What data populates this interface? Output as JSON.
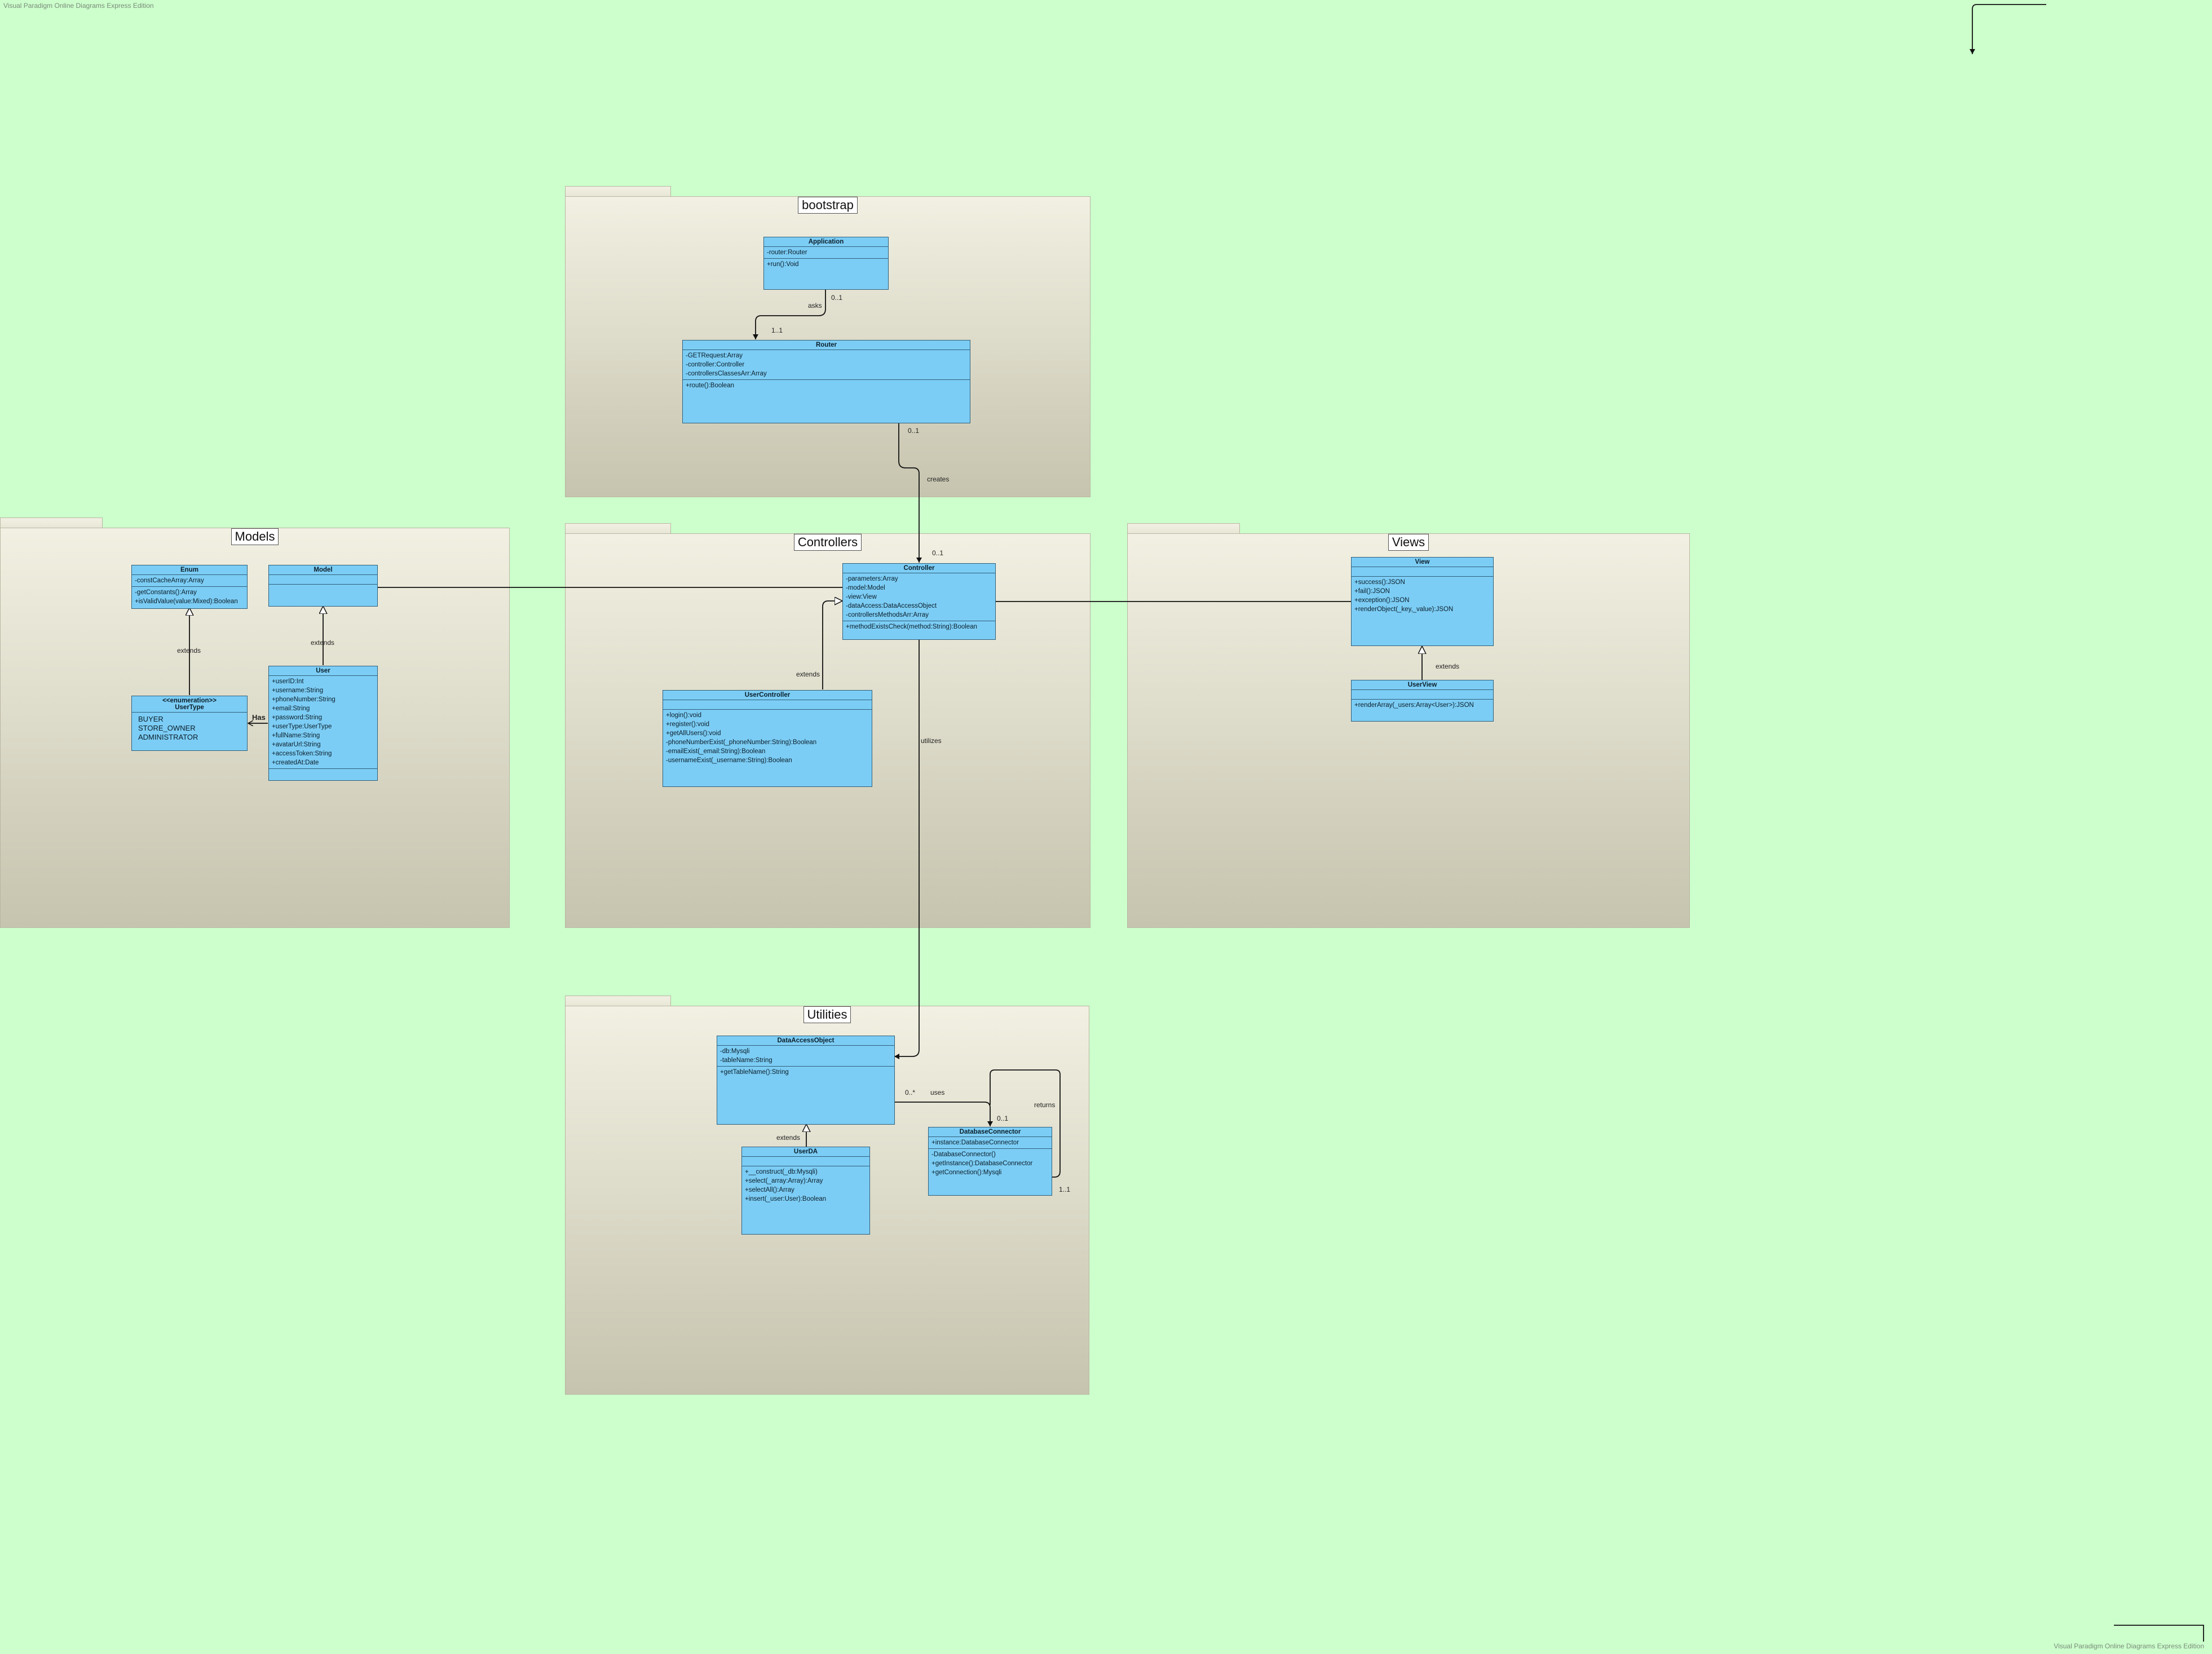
{
  "watermark": "Visual Paradigm Online Diagrams Express Edition",
  "packages": {
    "bootstrap": "bootstrap",
    "models": "Models",
    "controllers": "Controllers",
    "views": "Views",
    "utilities": "Utilities"
  },
  "classes": {
    "application": {
      "name": "Application",
      "attrs": [
        "-router:Router"
      ],
      "ops": [
        "+run():Void"
      ]
    },
    "router": {
      "name": "Router",
      "attrs": [
        "-GETRequest:Array",
        "-controller:Controller",
        "-controllersClassesArr:Array"
      ],
      "ops": [
        "+route():Boolean"
      ]
    },
    "enum": {
      "name": "Enum",
      "attrs": [
        "-constCacheArray:Array"
      ],
      "ops": [
        "-getConstants():Array",
        "+isValidValue(value:Mixed):Boolean"
      ]
    },
    "model": {
      "name": "Model",
      "attrs": [],
      "ops": []
    },
    "usertype": {
      "stereotype": "<<enumeration>>",
      "name": "UserType",
      "literals": [
        "BUYER",
        "STORE_OWNER",
        "ADMINISTRATOR"
      ]
    },
    "user": {
      "name": "User",
      "attrs": [
        "+userID:Int",
        "+username:String",
        "+phoneNumber:String",
        "+email:String",
        "+password:String",
        "+userType:UserType",
        "+fullName:String",
        "+avatarUrl:String",
        "+accessToken:String",
        "+createdAt:Date"
      ],
      "ops": []
    },
    "controller": {
      "name": "Controller",
      "attrs": [
        "-parameters:Array",
        "-model:Model",
        "-view:View",
        "-dataAccess:DataAccessObject",
        "-controllersMethodsArr:Array"
      ],
      "ops": [
        "+methodExistsCheck(method:String):Boolean"
      ]
    },
    "usercontroller": {
      "name": "UserController",
      "attrs": [],
      "ops": [
        "+login():void",
        "+register():void",
        "+getAllUsers():void",
        "-phoneNumberExist(_phoneNumber:String):Boolean",
        "-emailExist(_email:String):Boolean",
        "-usernameExist(_username:String):Boolean"
      ]
    },
    "view": {
      "name": "View",
      "attrs": [],
      "ops": [
        "+success():JSON",
        "+fail():JSON",
        "+exception():JSON",
        "+renderObject(_key,_value):JSON"
      ]
    },
    "userview": {
      "name": "UserView",
      "attrs": [],
      "ops": [
        "+renderArray(_users:Array<User>):JSON"
      ]
    },
    "dao": {
      "name": "DataAccessObject",
      "attrs": [
        "-db:Mysqli",
        "-tableName:String"
      ],
      "ops": [
        "+getTableName():String"
      ]
    },
    "userda": {
      "name": "UserDA",
      "attrs": [],
      "ops": [
        "+__construct(_db:Mysqli)",
        "+select(_array:Array):Array",
        "+selectAll():Array",
        "+insert(_user:User):Boolean"
      ]
    },
    "dbconnector": {
      "name": "DatabaseConnector",
      "attrs": [
        "+instance:DatabaseConnector"
      ],
      "ops": [
        "-DatabaseConnector()",
        "+getInstance():DatabaseConnector",
        "+getConnection():Mysqli"
      ]
    }
  },
  "labels": {
    "asks": "asks",
    "mult_app_router_src": "0..1",
    "mult_app_router_dst": "1..1",
    "creates": "creates",
    "mult_router_ctrl_src": "0..1",
    "mult_router_ctrl_dst": "0..1",
    "utilizes": "utilizes",
    "extends_usertype_enum": "extends",
    "extends_user_model": "extends",
    "has": "Has",
    "extends_usercontroller": "extends",
    "extends_userview": "extends",
    "extends_userda": "extends",
    "uses": "uses",
    "mult_uses_src": "0..*",
    "mult_uses_dst": "0..1",
    "returns": "returns",
    "mult_returns": "1..1"
  },
  "colors": {
    "background": "#ccffcc",
    "class_fill": "#7ccdf5",
    "class_border": "#2f5f7a"
  }
}
